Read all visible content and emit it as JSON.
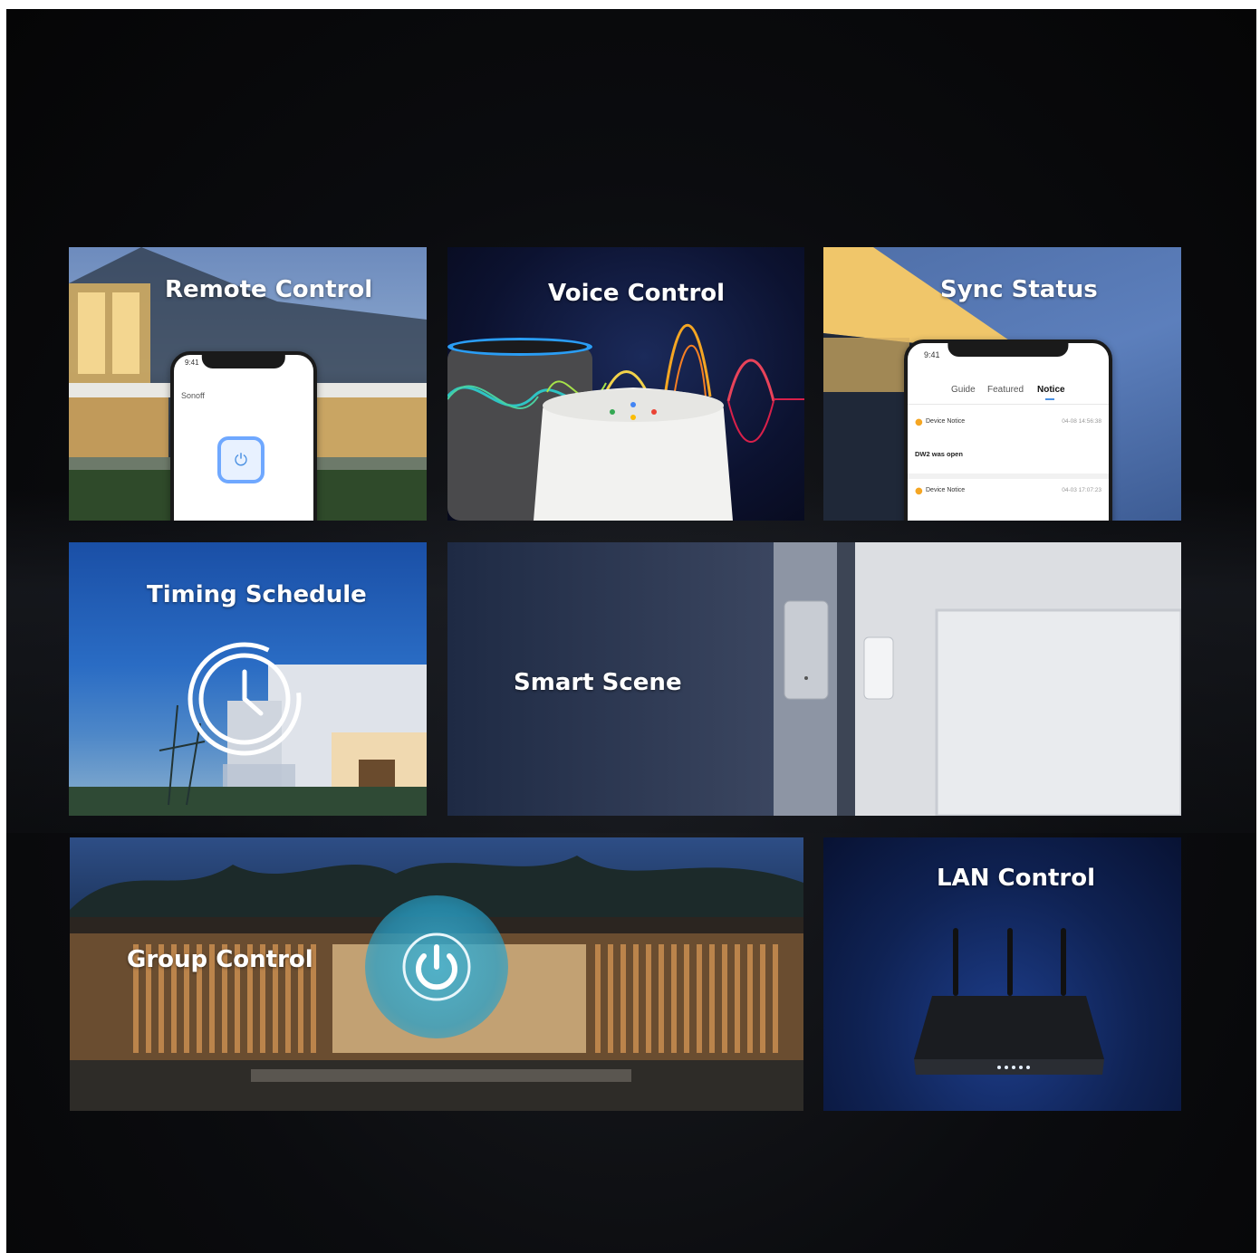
{
  "tiles": {
    "remote": {
      "title": "Remote Control",
      "phone_time": "9:41",
      "brand": "Sonoff"
    },
    "voice": {
      "title": "Voice Control"
    },
    "sync": {
      "title": "Sync Status",
      "phone_time": "9:41",
      "tabs": [
        "Guide",
        "Featured",
        "Notice"
      ],
      "active_tab": "Notice",
      "notices": [
        {
          "label": "Device Notice",
          "time": "04-08 14:56:38",
          "message": "DW2 was open"
        },
        {
          "label": "Device Notice",
          "time": "04-03 17:07:23",
          "message": ""
        }
      ]
    },
    "timing": {
      "title": "Timing Schedule"
    },
    "scene": {
      "title": "Smart Scene"
    },
    "group": {
      "title": "Group Control"
    },
    "lan": {
      "title": "LAN Control"
    }
  },
  "colors": {
    "accent_blue": "#4a90e2",
    "notice_orange": "#f5a623",
    "background": "#0b0c0f"
  }
}
